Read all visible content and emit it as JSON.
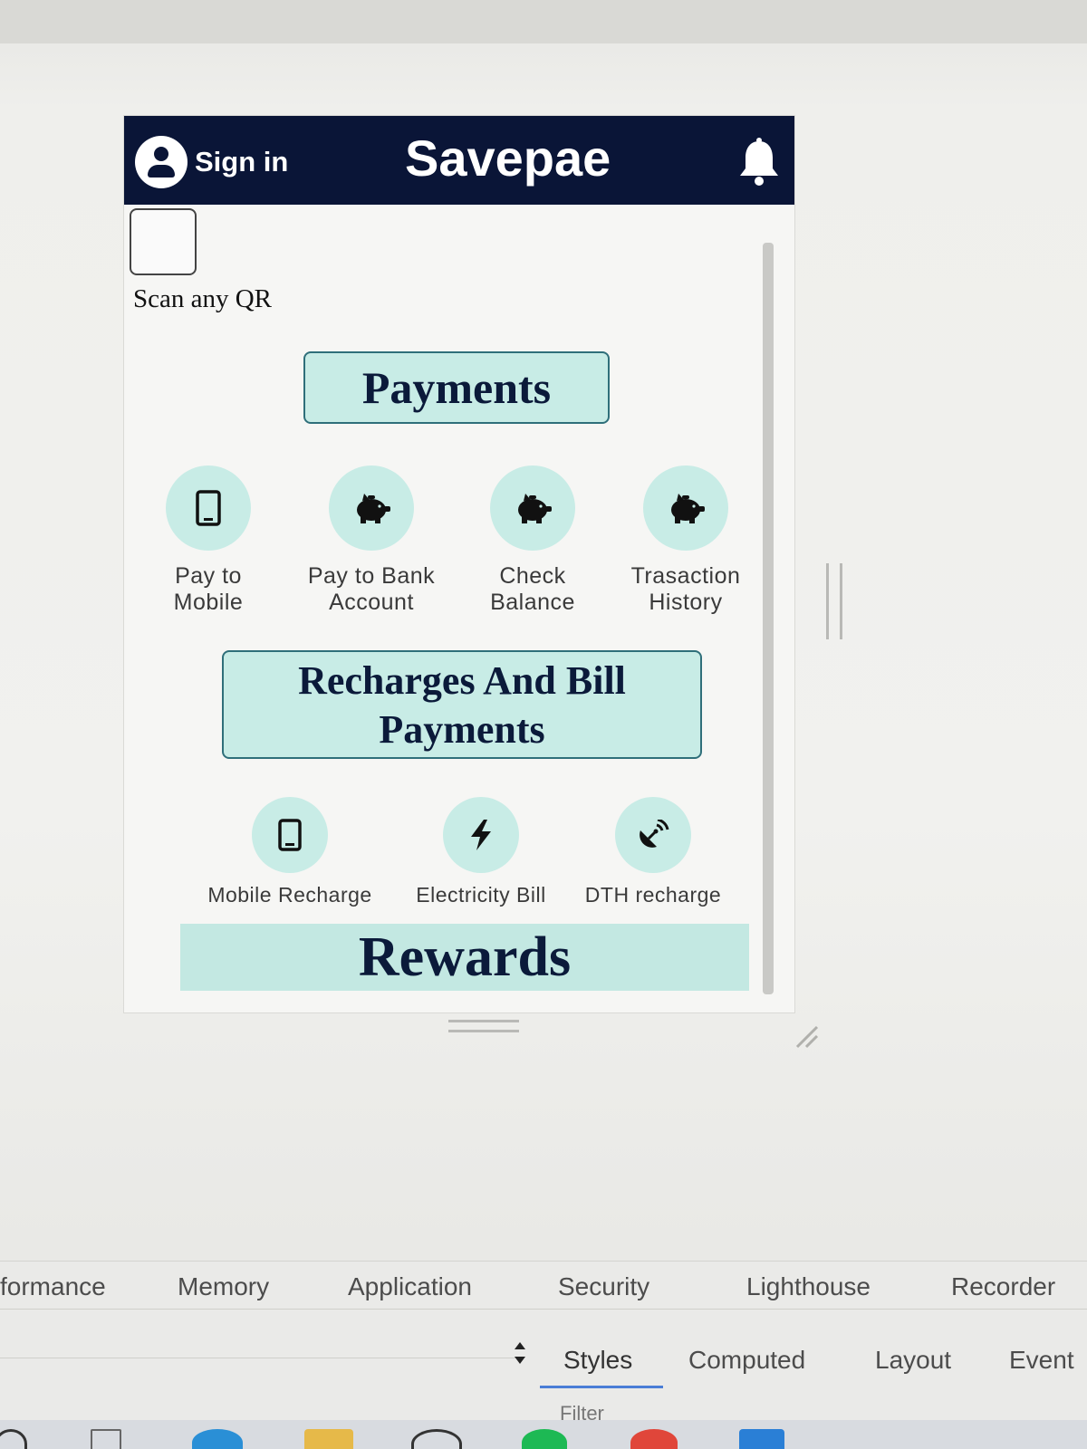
{
  "header": {
    "signin_label": "Sign in",
    "app_title": "Savepae",
    "icons": {
      "avatar": "user-circle-icon",
      "notifications": "bell-icon"
    }
  },
  "scan": {
    "label": "Scan any QR"
  },
  "payments": {
    "heading": "Payments",
    "items": [
      {
        "label_line1": "Pay to",
        "label_line2": "Mobile",
        "icon": "mobile-phone-icon"
      },
      {
        "label_line1": "Pay to Bank",
        "label_line2": "Account",
        "icon": "piggy-bank-icon"
      },
      {
        "label_line1": "Check",
        "label_line2": "Balance",
        "icon": "piggy-bank-icon"
      },
      {
        "label_line1": "Trasaction",
        "label_line2": "History",
        "icon": "piggy-bank-icon"
      }
    ]
  },
  "bills": {
    "heading_line1": "Recharges And Bill",
    "heading_line2": "Payments",
    "items": [
      {
        "label": "Mobile Recharge",
        "icon": "mobile-phone-icon"
      },
      {
        "label": "Electricity Bill",
        "icon": "lightning-bolt-icon"
      },
      {
        "label": "DTH recharge",
        "icon": "satellite-dish-icon"
      }
    ]
  },
  "rewards": {
    "heading": "Rewards"
  },
  "devtools": {
    "tabs": [
      "formance",
      "Memory",
      "Application",
      "Security",
      "Lighthouse",
      "Recorder"
    ],
    "subtabs": [
      "Styles",
      "Computed",
      "Layout",
      "Event"
    ],
    "active_subtab": "Styles",
    "filter_label": "Filter"
  },
  "colors": {
    "header_bg": "#0a1537",
    "accent_teal": "#c8ece6",
    "heading_text": "#0b1a3a"
  }
}
